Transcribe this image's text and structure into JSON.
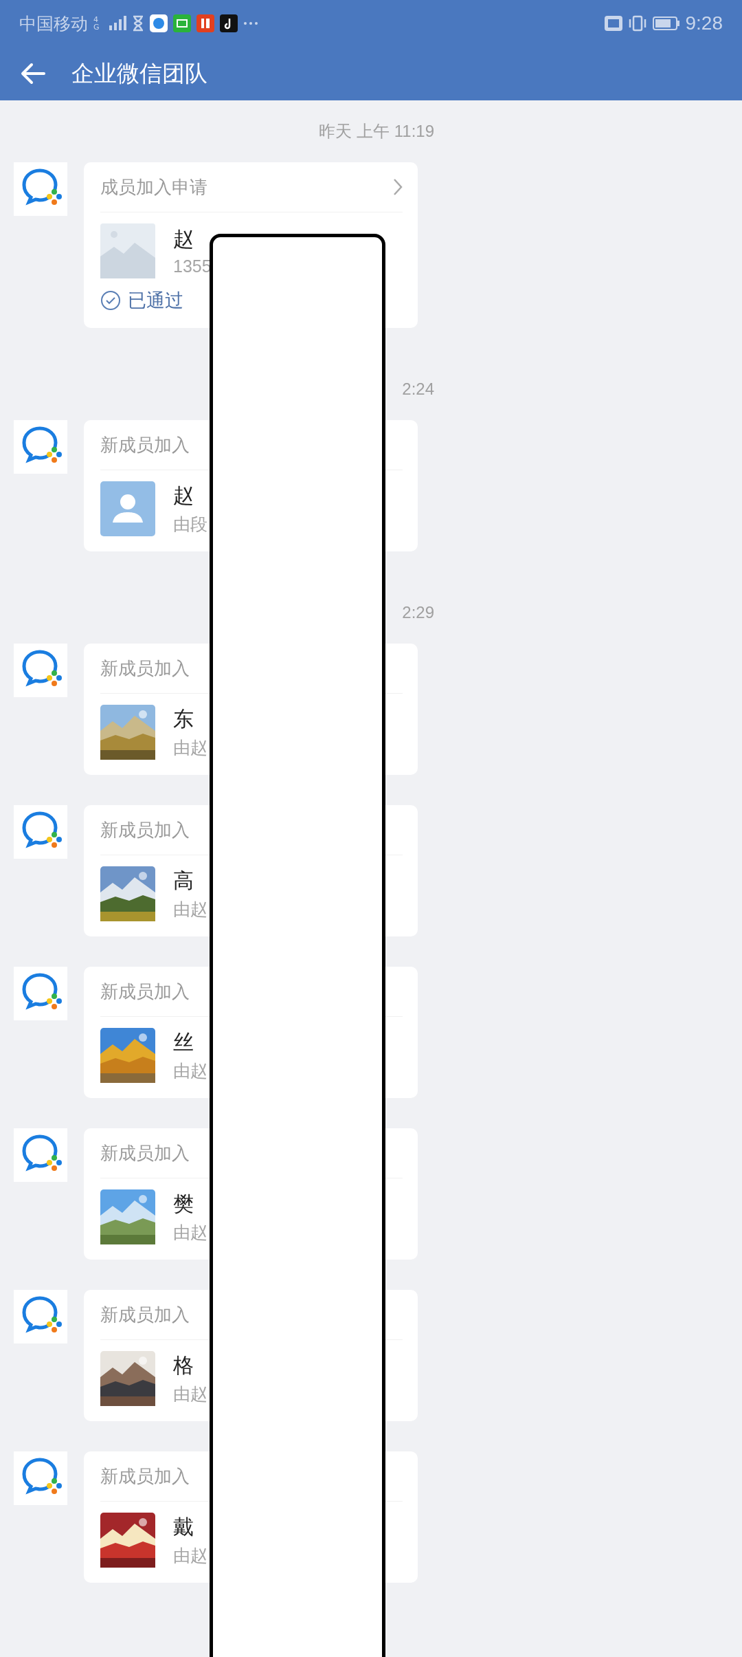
{
  "status_bar": {
    "carrier": "中国移动",
    "network": "4G",
    "time": "9:28"
  },
  "header": {
    "title": "企业微信团队"
  },
  "feed": [
    {
      "kind": "time",
      "text": "昨天  上午 11:19"
    },
    {
      "kind": "card",
      "title": "成员加入申请",
      "chevron": true,
      "thumb": {
        "kind": "placeholder"
      },
      "name": "赵",
      "sub": "1355",
      "status": "已通过"
    },
    {
      "kind": "time",
      "text": "2:24"
    },
    {
      "kind": "card",
      "title": "新成员加入",
      "chevron": false,
      "thumb": {
        "kind": "avatar"
      },
      "name": "赵",
      "sub": "由段"
    },
    {
      "kind": "time",
      "text": "2:29"
    },
    {
      "kind": "card",
      "title": "新成员加入",
      "chevron": false,
      "name": "东",
      "sub": "由赵"
    },
    {
      "kind": "card",
      "title": "新成员加入",
      "chevron": false,
      "name": "高",
      "sub": "由赵"
    },
    {
      "kind": "card",
      "title": "新成员加入",
      "chevron": false,
      "name": "丝",
      "sub": "由赵"
    },
    {
      "kind": "card",
      "title": "新成员加入",
      "chevron": false,
      "name": "樊",
      "sub": "由赵"
    },
    {
      "kind": "card",
      "title": "新成员加入",
      "chevron": false,
      "name": "格",
      "sub": "由赵"
    },
    {
      "kind": "card",
      "title": "新成员加入",
      "chevron": false,
      "name": "戴",
      "sub": "由赵"
    }
  ]
}
